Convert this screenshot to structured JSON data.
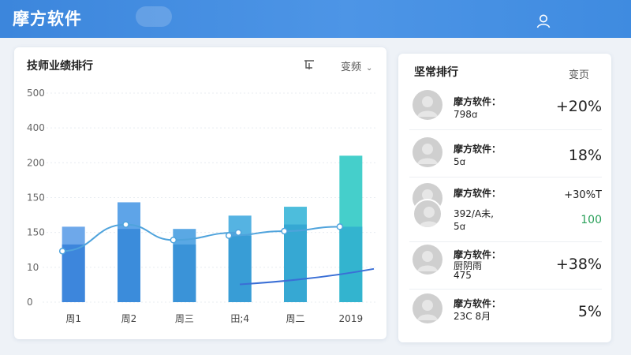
{
  "header": {
    "app_title": "摩方软件",
    "user_icon": "user-icon"
  },
  "performance": {
    "title": "技师业绩排行",
    "filter_icon": "filter-icon",
    "dropdown_label": "变频",
    "dropdown_icon": "chevron-down-icon"
  },
  "chart_data": {
    "type": "bar",
    "title": "",
    "xlabel": "",
    "ylabel": "",
    "y_ticks": [
      "500",
      "400",
      "200",
      "150",
      "150",
      "10",
      "0"
    ],
    "categories": [
      "周1",
      "周2",
      "周三",
      "田;4",
      "周二",
      "2019"
    ],
    "bars_total": [
      170,
      225,
      165,
      195,
      215,
      330
    ],
    "bars_base": [
      130,
      165,
      130,
      150,
      175,
      170
    ],
    "line_series": [
      115,
      175,
      140,
      150,
      160,
      170
    ],
    "trend_series": [
      40,
      75
    ],
    "colors": {
      "bar_light": [
        "#6ea8ea",
        "#5ea4e8",
        "#5aa8e4",
        "#55b3e2",
        "#4dbddc",
        "#45cfcb"
      ],
      "bar_dark": [
        "#3d86dc",
        "#3b8cdb",
        "#3a93d8",
        "#389dd6",
        "#36a8d3",
        "#33b4cf"
      ],
      "line": "#4fa3dc",
      "trend": "#3a6fd6"
    }
  },
  "ranking": {
    "title": "坚常排行",
    "more_label": "变页",
    "items": [
      {
        "name": "摩方软件：",
        "sub": "798ꭤ",
        "value": "+20%",
        "style": ""
      },
      {
        "name": "摩方软件：",
        "sub": "5ꭤ",
        "value": "18%",
        "style": ""
      },
      {
        "name": "摩方软件：",
        "sub": "392/A未,",
        "sub2": "5ꭤ",
        "value": "+30%T",
        "value2": "100",
        "style": "small"
      },
      {
        "name": "摩方软件：",
        "sub": "厨阴雨",
        "sub2": "475",
        "value": "+38%",
        "style": ""
      },
      {
        "name": "摩方软件：",
        "sub": "23C 8月",
        "value": "5%",
        "style": ""
      }
    ]
  }
}
